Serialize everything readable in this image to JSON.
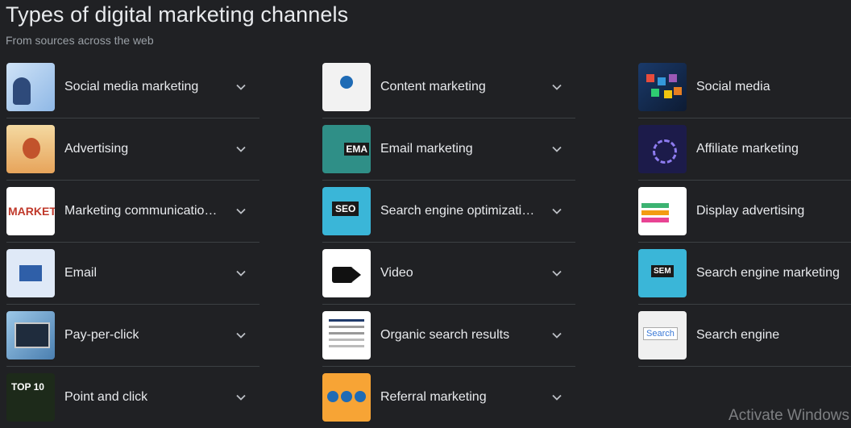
{
  "header": {
    "title": "Types of digital marketing channels",
    "subtitle": "From sources across the web"
  },
  "columns": [
    {
      "items": [
        {
          "label": "Social media marketing",
          "thumb": "social-media-marketing-thumbnail"
        },
        {
          "label": "Advertising",
          "thumb": "advertising-thumbnail"
        },
        {
          "label": "Marketing communicatio…",
          "thumb": "marketing-communications-thumbnail"
        },
        {
          "label": "Email",
          "thumb": "email-thumbnail"
        },
        {
          "label": "Pay-per-click",
          "thumb": "pay-per-click-thumbnail"
        },
        {
          "label": "Point and click",
          "thumb": "point-and-click-thumbnail"
        }
      ]
    },
    {
      "items": [
        {
          "label": "Content marketing",
          "thumb": "content-marketing-thumbnail"
        },
        {
          "label": "Email marketing",
          "thumb": "email-marketing-thumbnail"
        },
        {
          "label": "Search engine optimizati…",
          "thumb": "seo-thumbnail"
        },
        {
          "label": "Video",
          "thumb": "video-thumbnail"
        },
        {
          "label": "Organic search results",
          "thumb": "organic-search-thumbnail"
        },
        {
          "label": "Referral marketing",
          "thumb": "referral-marketing-thumbnail"
        }
      ]
    },
    {
      "items": [
        {
          "label": "Social media",
          "thumb": "social-media-thumbnail"
        },
        {
          "label": "Affiliate marketing",
          "thumb": "affiliate-marketing-thumbnail"
        },
        {
          "label": "Display advertising",
          "thumb": "display-advertising-thumbnail"
        },
        {
          "label": "Search engine marketing",
          "thumb": "sem-thumbnail"
        },
        {
          "label": "Search engine",
          "thumb": "search-engine-thumbnail"
        }
      ]
    }
  ],
  "icons": {
    "expand": "chevron-down-icon"
  },
  "colors": {
    "background": "#202124",
    "text": "#e8eaed",
    "muted": "#9aa0a6",
    "divider": "#3c4043"
  },
  "watermark": "Activate Windows"
}
